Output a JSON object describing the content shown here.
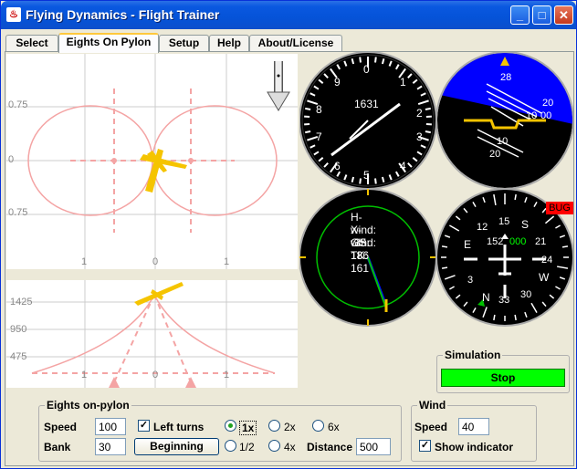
{
  "window": {
    "title": "Flying Dynamics - Flight Trainer"
  },
  "tabs": [
    {
      "label": "Select"
    },
    {
      "label": "Eights On Pylon"
    },
    {
      "label": "Setup"
    },
    {
      "label": "Help"
    },
    {
      "label": "About/License"
    }
  ],
  "plot_top": {
    "y_labels": [
      "0.75",
      "0",
      "0.75"
    ],
    "x_labels": [
      "1",
      "0",
      "1"
    ]
  },
  "plot_bottom": {
    "y_labels": [
      "1425",
      "950",
      "475"
    ],
    "x_labels": [
      "1",
      "0",
      "1"
    ]
  },
  "clock_gauge": {
    "numbers": [
      "0",
      "1",
      "2",
      "3",
      "4",
      "5",
      "6",
      "7",
      "8",
      "9"
    ],
    "center_text": "1631"
  },
  "attitude": {
    "labels": [
      "28",
      "20",
      "10",
      "00",
      "10",
      "20"
    ]
  },
  "wind_gauge": {
    "hwind": "H-wind: -35",
    "xwind": "X-wind: 18",
    "gs": "GS: 136",
    "tk": "TK: 161"
  },
  "heading_gauge": {
    "hdg": "152",
    "hdg2": "000",
    "cardinal": [
      "15",
      "S",
      "21",
      "24",
      "W",
      "30",
      "33",
      "N",
      "3",
      "E",
      "12"
    ],
    "bug_label": "BUG"
  },
  "simulation": {
    "title": "Simulation",
    "stop_label": "Stop"
  },
  "eights": {
    "title": "Eights on-pylon",
    "speed_label": "Speed",
    "speed_value": "100",
    "bank_label": "Bank",
    "bank_value": "30",
    "left_turns_label": "Left turns",
    "beginning_label": "Beginning",
    "rate_1x": "1x",
    "rate_2x": "2x",
    "rate_6x": "6x",
    "rate_half": "1/2",
    "rate_4x": "4x",
    "distance_label": "Distance",
    "distance_value": "500"
  },
  "wind": {
    "title": "Wind",
    "speed_label": "Speed",
    "speed_value": "40",
    "show_indicator_label": "Show indicator"
  }
}
